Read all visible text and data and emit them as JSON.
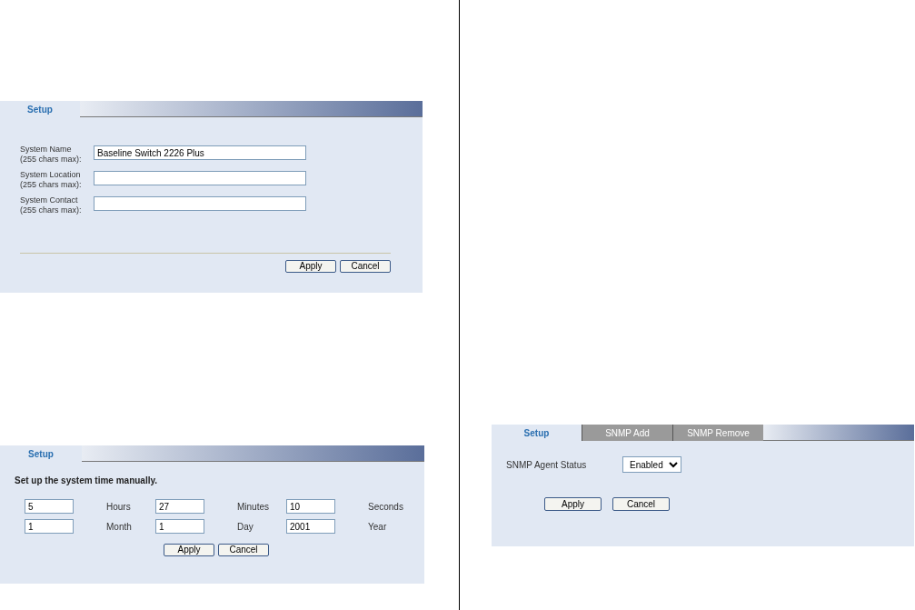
{
  "panels": [
    {
      "kind": "system_info",
      "tabs": [
        {
          "label": "Setup",
          "selected": true
        }
      ],
      "fields": [
        {
          "label": "System Name",
          "hint": "(255 chars max):",
          "value": "Baseline Switch 2226 Plus"
        },
        {
          "label": "System Location",
          "hint": "(255 chars max):"
        },
        {
          "label": "System Contact",
          "hint": "(255 chars max):"
        }
      ],
      "buttons": [
        "Apply",
        "Cancel"
      ]
    },
    {
      "kind": "system_time",
      "tabs": [
        {
          "label": "Setup",
          "selected": true
        }
      ],
      "intro": "Set up the system time manually.",
      "rows": [
        [
          {
            "value": "5",
            "unit": "Hours"
          },
          {
            "value": "27",
            "unit": "Minutes"
          },
          {
            "value": "10",
            "unit": "Seconds"
          }
        ],
        [
          {
            "value": "1",
            "unit": "Month"
          },
          {
            "value": "1",
            "unit": "Day"
          },
          {
            "value": "2001",
            "unit": "Year"
          }
        ]
      ],
      "buttons": [
        "Apply",
        "Cancel"
      ]
    },
    {
      "kind": "snmp",
      "tabs": [
        {
          "label": "Setup",
          "selected": true
        },
        {
          "label": "SNMP Add",
          "selected": false
        },
        {
          "label": "SNMP Remove",
          "selected": false
        }
      ],
      "field": {
        "label": "SNMP Agent Status",
        "value": "Enabled"
      },
      "buttons": [
        "Apply",
        "Cancel"
      ]
    }
  ]
}
